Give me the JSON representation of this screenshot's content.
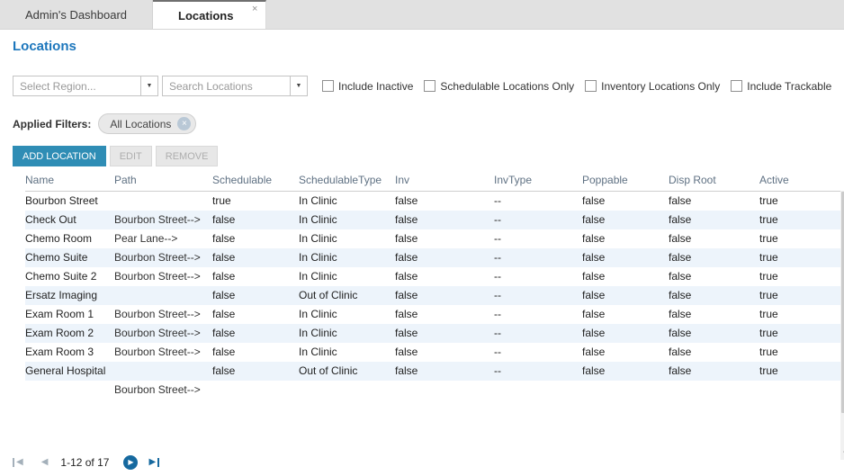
{
  "colors": {
    "accent": "#2f8db5",
    "link": "#1c76bc",
    "row_alt": "#edf4fb",
    "pager_active": "#16699f"
  },
  "tabs": [
    {
      "label": "Admin's Dashboard",
      "active": false
    },
    {
      "label": "Locations",
      "active": true,
      "close": "×"
    }
  ],
  "page": {
    "title": "Locations"
  },
  "filters": {
    "region_placeholder": "Select Region...",
    "search_placeholder": "Search Locations",
    "dropdown_arrow": "▼",
    "checkboxes": [
      {
        "label": "Include Inactive",
        "checked": false
      },
      {
        "label": "Schedulable Locations Only",
        "checked": false
      },
      {
        "label": "Inventory Locations Only",
        "checked": false
      },
      {
        "label": "Include Trackable",
        "checked": false
      }
    ],
    "applied_label": "Applied Filters:",
    "chips": [
      {
        "label": "All Locations",
        "remove": "×"
      }
    ]
  },
  "toolbar": {
    "add": "ADD LOCATION",
    "edit": "EDIT",
    "remove": "REMOVE"
  },
  "table": {
    "columns": [
      "Name",
      "Path",
      "Schedulable",
      "SchedulableType",
      "Inv",
      "InvType",
      "Poppable",
      "Disp Root",
      "Active"
    ],
    "rows": [
      [
        "Bourbon Street",
        "",
        "true",
        "In Clinic",
        "false",
        "--",
        "false",
        "false",
        "true"
      ],
      [
        "Check Out",
        "Bourbon Street-->",
        "false",
        "In Clinic",
        "false",
        "--",
        "false",
        "false",
        "true"
      ],
      [
        "Chemo Room",
        "Pear Lane-->",
        "false",
        "In Clinic",
        "false",
        "--",
        "false",
        "false",
        "true"
      ],
      [
        "Chemo Suite",
        "Bourbon Street-->",
        "false",
        "In Clinic",
        "false",
        "--",
        "false",
        "false",
        "true"
      ],
      [
        "Chemo Suite 2",
        "Bourbon Street-->",
        "false",
        "In Clinic",
        "false",
        "--",
        "false",
        "false",
        "true"
      ],
      [
        "Ersatz Imaging",
        "",
        "false",
        "Out of Clinic",
        "false",
        "--",
        "false",
        "false",
        "true"
      ],
      [
        "Exam Room 1",
        "Bourbon Street-->",
        "false",
        "In Clinic",
        "false",
        "--",
        "false",
        "false",
        "true"
      ],
      [
        "Exam Room 2",
        "Bourbon Street-->",
        "false",
        "In Clinic",
        "false",
        "--",
        "false",
        "false",
        "true"
      ],
      [
        "Exam Room 3",
        "Bourbon Street-->",
        "false",
        "In Clinic",
        "false",
        "--",
        "false",
        "false",
        "true"
      ],
      [
        "General Hospital",
        "",
        "false",
        "Out of Clinic",
        "false",
        "--",
        "false",
        "false",
        "true"
      ],
      [
        "",
        "Bourbon Street-->",
        "",
        "",
        "",
        "",
        "",
        "",
        ""
      ]
    ]
  },
  "scrollbar": {
    "down_arrow": "▼"
  },
  "pagination": {
    "first": "◀",
    "prev": "◀",
    "range": "1-12 of 17",
    "next": "▶",
    "last": "▶"
  }
}
